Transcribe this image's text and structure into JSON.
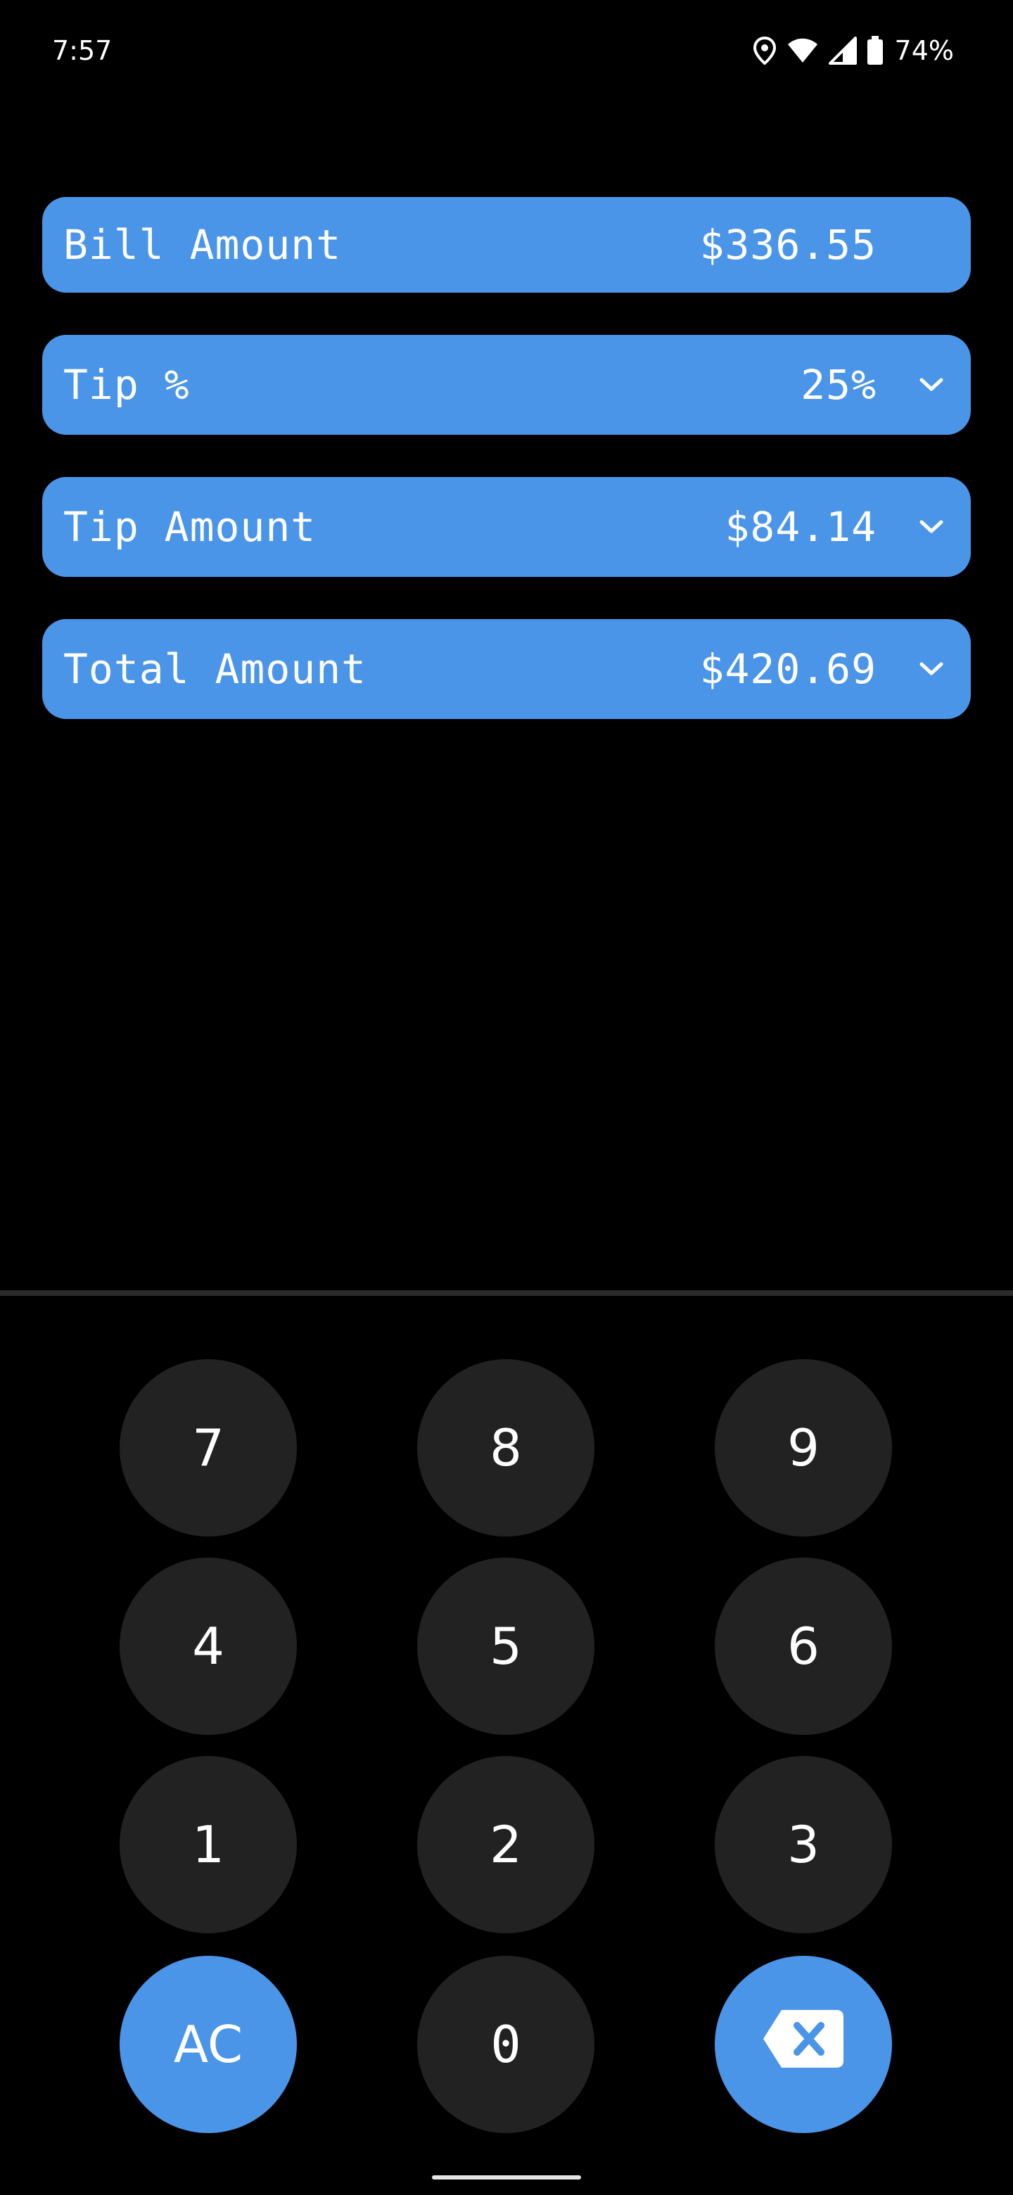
{
  "status_bar": {
    "time": "7:57",
    "battery_percent": "74%",
    "icons": [
      "location-icon",
      "wifi-icon",
      "signal-icon",
      "battery-icon"
    ]
  },
  "fields": {
    "bill": {
      "label": "Bill Amount",
      "value": "$336.55"
    },
    "tip_percent": {
      "label": "Tip %",
      "value": "25%"
    },
    "tip_amount": {
      "label": "Tip Amount",
      "value": "$84.14"
    },
    "total_amount": {
      "label": "Total Amount",
      "value": "$420.69"
    }
  },
  "keypad": {
    "k7": "7",
    "k8": "8",
    "k9": "9",
    "k4": "4",
    "k5": "5",
    "k6": "6",
    "k1": "1",
    "k2": "2",
    "k3": "3",
    "clear": "AC",
    "k0": "0",
    "backspace_icon": "backspace-icon"
  },
  "colors": {
    "background": "#000000",
    "accent": "#4a95e8",
    "key": "#222222",
    "divider": "#2a2a2a"
  }
}
